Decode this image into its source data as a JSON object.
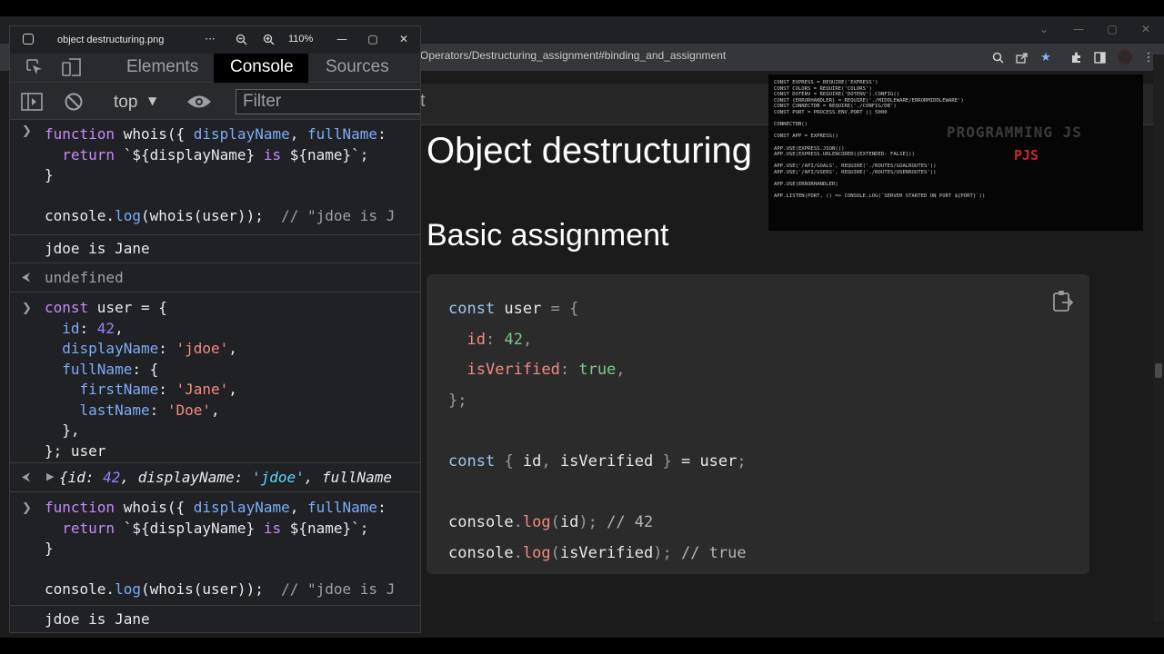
{
  "browser": {
    "url": "Operators/Destructuring_assignment#binding_and_assignment",
    "window_controls": [
      "⌄",
      "—",
      "▢",
      "✕"
    ],
    "toolbar_icons": [
      "zoom-icon",
      "share-icon",
      "star-icon",
      "extensions-icon",
      "sidebar-icon",
      "profile-avatar",
      "menu-icon"
    ],
    "accent_color": "#8ab4f8"
  },
  "page": {
    "heading_fragment": "t",
    "h1": "Object destructuring",
    "h2": "Basic assignment",
    "code_lines": [
      "const user = {",
      "  id: 42,",
      "  isVerified: true,",
      "};",
      "",
      "const { id, isVerified } = user;",
      "",
      "console.log(id); // 42",
      "console.log(isVerified); // true"
    ]
  },
  "thumbnail": {
    "title": "PROGRAMMING JS",
    "subtitle": "PJS",
    "code_lines": [
      "CONST EXPRESS = REQUIRE('EXPRESS')",
      "CONST COLORS = REQUIRE('COLORS')",
      "CONST DOTENV = REQUIRE('DOTENV').CONFIG()",
      "CONST {ERRORHANDLER} = REQUIRE('./MIDDLEWARE/ERRORMIDDLEWARE')",
      "CONST CONNECTDB = REQUIRE('./CONFIG/DB')",
      "CONST PORT = PROCESS.ENV.PORT || 5000",
      "",
      "CONNECTDB()",
      "",
      "CONST APP = EXPRESS()",
      "",
      "APP.USE(EXPRESS.JSON())",
      "APP.USE(EXPRESS.URLENCODED({EXTENDED: FALSE}))",
      "",
      "APP.USE('/API/GOALS', REQUIRE('./ROUTES/GOALROUTES'))",
      "APP.USE('/API/USERS', REQUIRE('./ROUTES/USERROUTES'))",
      "",
      "APP.USE(ERRORHANDLER)",
      "",
      "APP.LISTEN(PORT, () => CONSOLE.LOG(`SERVER STARTED ON PORT ${PORT}`))"
    ]
  },
  "viewer": {
    "filename": "object destructuring.png",
    "more_label": "···",
    "zoom_level": "110%"
  },
  "devtools": {
    "tabs": [
      "Elements",
      "Console",
      "Sources"
    ],
    "active_tab": "Console",
    "context": "top",
    "filter_placeholder": "Filter",
    "console": {
      "entry1": [
        "function whois({ displayName, fullName:",
        "  return `${displayName} is ${name}`;",
        "}",
        "",
        "console.log(whois(user));  // \"jdoe is J"
      ],
      "out1": "jdoe is Jane",
      "out2": "undefined",
      "entry2": [
        "const user = {",
        "  id: 42,",
        "  displayName: 'jdoe',",
        "  fullName: {",
        "    firstName: 'Jane',",
        "    lastName: 'Doe',",
        "  },",
        "}; user"
      ],
      "out3": "{id: 42, displayName: 'jdoe', fullName",
      "entry3": [
        "function whois({ displayName, fullName:",
        "  return `${displayName} is ${name}`;",
        "}",
        "",
        "console.log(whois(user));  // \"jdoe is J"
      ],
      "out4": "jdoe is Jane"
    }
  }
}
